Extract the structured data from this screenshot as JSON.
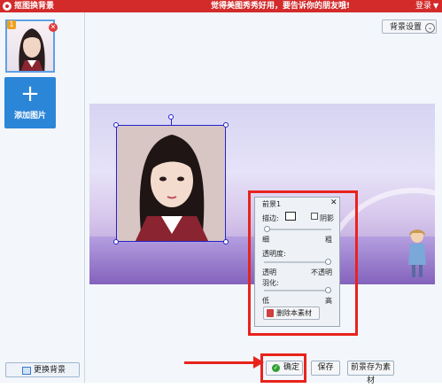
{
  "titlebar": {
    "app_title": "抠图换背景",
    "slogan": "觉得美图秀秀好用，要告诉你的朋友哦!",
    "login": "登录",
    "menu_arrow": "▼"
  },
  "sidebar": {
    "thumbnail_badge": "1",
    "thumbnail_close": "✕",
    "add_plus": "+",
    "add_label": "添加图片",
    "change_bg_label": "更换背景"
  },
  "toolbar": {
    "bg_settings_label": "背景设置",
    "bg_settings_chevron": "⌄"
  },
  "fg_panel": {
    "title": "前景1",
    "close": "✕",
    "stroke_label": "描边:",
    "shadow_label": "阴影",
    "thin_label": "细",
    "thick_label": "粗",
    "opacity_label": "透明度:",
    "transparent_label": "透明",
    "opaque_label": "不透明",
    "feather_label": "羽化:",
    "low_label": "低",
    "high_label": "高",
    "delete_label": "删除本素材",
    "stroke_value": 0.0,
    "opacity_value": 1.0,
    "feather_value": 1.0
  },
  "footer": {
    "ok_label": "确定",
    "save_label": "保存",
    "save_as_material_label": "前景存为素材"
  },
  "colors": {
    "titlebar": "#d32a2a",
    "accent_blue": "#2c86d8",
    "selection": "#2424c8",
    "annotation_red": "#e8231c"
  }
}
